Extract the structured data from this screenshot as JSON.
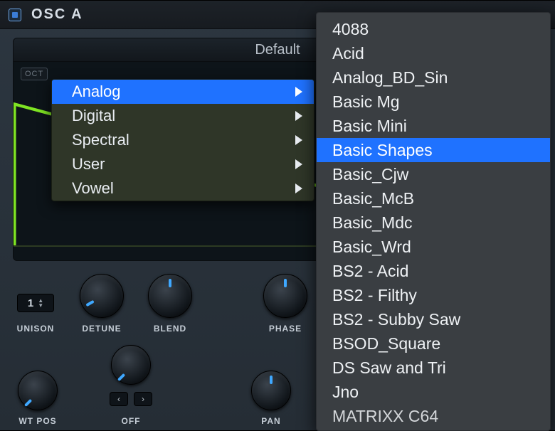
{
  "header": {
    "title": "OSC A"
  },
  "display": {
    "preset_label": "Default",
    "oct_label": "OCT"
  },
  "knobs_row1": {
    "unison_label": "UNISON",
    "unison_value": "1",
    "detune": "DETUNE",
    "blend": "BLEND",
    "phase": "PHASE"
  },
  "knobs_row2": {
    "wtpos": "WT POS",
    "off": "OFF",
    "pan": "PAN"
  },
  "category_menu": {
    "items": [
      {
        "label": "Analog",
        "has_children": true,
        "selected": true
      },
      {
        "label": "Digital",
        "has_children": true,
        "selected": false
      },
      {
        "label": "Spectral",
        "has_children": true,
        "selected": false
      },
      {
        "label": "User",
        "has_children": true,
        "selected": false
      },
      {
        "label": "Vowel",
        "has_children": true,
        "selected": false
      }
    ]
  },
  "preset_menu": {
    "items": [
      {
        "label": "4088",
        "selected": false
      },
      {
        "label": "Acid",
        "selected": false
      },
      {
        "label": "Analog_BD_Sin",
        "selected": false
      },
      {
        "label": "Basic Mg",
        "selected": false
      },
      {
        "label": "Basic Mini",
        "selected": false
      },
      {
        "label": "Basic Shapes",
        "selected": true
      },
      {
        "label": "Basic_Cjw",
        "selected": false
      },
      {
        "label": "Basic_McB",
        "selected": false
      },
      {
        "label": "Basic_Mdc",
        "selected": false
      },
      {
        "label": "Basic_Wrd",
        "selected": false
      },
      {
        "label": "BS2 - Acid",
        "selected": false
      },
      {
        "label": "BS2 - Filthy",
        "selected": false
      },
      {
        "label": "BS2 - Subby Saw",
        "selected": false
      },
      {
        "label": "BSOD_Square",
        "selected": false
      },
      {
        "label": "DS Saw and Tri",
        "selected": false
      },
      {
        "label": "Jno",
        "selected": false
      },
      {
        "label": "MATRIXX C64",
        "selected": false
      }
    ]
  }
}
